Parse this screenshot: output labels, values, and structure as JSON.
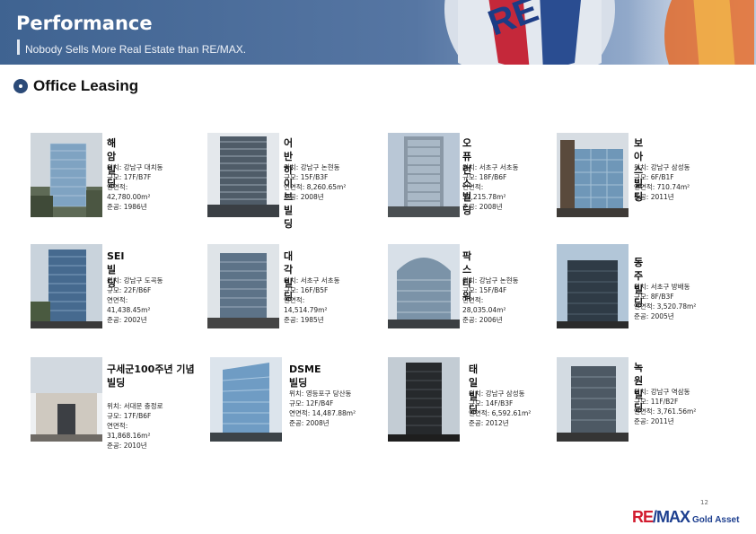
{
  "header": {
    "title": "Performance",
    "subtitle": "Nobody Sells More Real Estate than RE/MAX."
  },
  "section": {
    "title": "Office Leasing"
  },
  "buildings": [
    {
      "name": "해암빌딩",
      "location": "위치: 강남구 대치동",
      "scale": "규모: 17F/B7F",
      "area_label": "연면적:",
      "area": "42,780.00m²",
      "completed": "준공: 1986년"
    },
    {
      "name": "어반하이브빌딩",
      "location": "위치: 강남구 논현동",
      "scale": "규모: 15F/B3F",
      "area_label": "연면적: 8,260.65m²",
      "area": "",
      "completed": "준공: 2008년"
    },
    {
      "name": "오퓨런스빌딩",
      "location": "위치: 서초구 서초동",
      "scale": "규모: 18F/B6F",
      "area_label": "연면적:",
      "area": "31,215.78m²",
      "completed": "준공: 2008년"
    },
    {
      "name": "보아스빌딩",
      "location": "위치: 강남구 삼성동",
      "scale": "규모: 6F/B1F",
      "area_label": "연면적: 710.74m²",
      "area": "",
      "completed": "준공: 2011년"
    },
    {
      "name": "SEI빌딩",
      "location": "위치: 강남구 도곡동",
      "scale": "규모: 22F/B6F",
      "area_label": "연면적:",
      "area": "41,438.45m²",
      "completed": "준공: 2002년"
    },
    {
      "name": "대각빌딩",
      "location": "위치: 서초구 서초동",
      "scale": "규모: 16F/B5F",
      "area_label": "연면적:",
      "area": "14,514.79m²",
      "completed": "준공: 1985년"
    },
    {
      "name": "팍스타워",
      "location": "위치: 강남구 논현동",
      "scale": "규모: 15F/B4F",
      "area_label": "연면적:",
      "area": "28,035.04m²",
      "completed": "준공: 2006년"
    },
    {
      "name": "동주빌딩",
      "location": "위치: 서초구 방배동",
      "scale": "규모: 8F/B3F",
      "area_label": "연면적: 3,520.78m²",
      "area": "",
      "completed": "준공: 2005년"
    },
    {
      "name": "구세군100주년 기념빌딩",
      "location": "위치: 서대문 충정로",
      "scale": "규모: 17F/B6F",
      "area_label": "연면적:",
      "area": "31,868.16m²",
      "completed": "준공: 2010년"
    },
    {
      "name": "DSME빌딩",
      "location": "위치: 영등포구 당산동",
      "scale": "규모: 12F/B4F",
      "area_label": "연면적: 14,487.88m²",
      "area": "",
      "completed": "준공: 2008년"
    },
    {
      "name": "태일빌딩",
      "location": "위치: 강남구 삼성동",
      "scale": "규모: 14F/B3F",
      "area_label": "연면적: 6,592.61m²",
      "area": "",
      "completed": "준공: 2012년"
    },
    {
      "name": "녹원빌딩",
      "location": "위치: 강남구 역삼동",
      "scale": "규모: 11F/B2F",
      "area_label": "연면적: 3,761.56m²",
      "area": "",
      "completed": "준공: 2011년"
    }
  ],
  "footer": {
    "page_number": "12",
    "logo_re": "RE",
    "logo_max": "/MAX",
    "logo_suffix": "Gold Asset"
  },
  "colors": {
    "header_blue": "#4a6a98",
    "brand_red": "#d21c2f",
    "brand_blue": "#1d3f8f"
  }
}
